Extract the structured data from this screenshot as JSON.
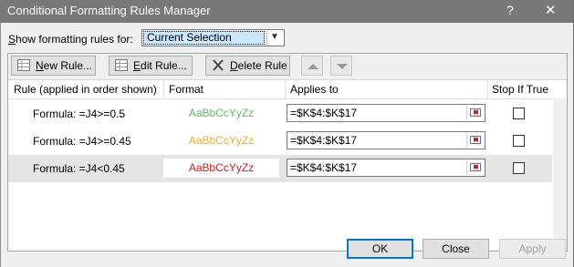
{
  "window": {
    "title": "Conditional Formatting Rules Manager",
    "help_label": "?",
    "close_label": "✕"
  },
  "show_rules": {
    "label_before": "",
    "label_accel": "S",
    "label_after": "how formatting rules for:",
    "selected": "Current Selection"
  },
  "toolbar": {
    "new_rule": {
      "accel": "N",
      "rest": "ew Rule..."
    },
    "edit_rule": {
      "accel": "E",
      "rest": "dit Rule..."
    },
    "delete_rule": {
      "accel": "D",
      "rest": "elete Rule"
    }
  },
  "columns": {
    "rule": "Rule (applied in order shown)",
    "format": "Format",
    "applies_to": "Applies to",
    "stop_if_true": "Stop If True"
  },
  "rules": [
    {
      "rule": "Formula: =J4>=0.5",
      "preview": "AaBbCcYyZz",
      "preview_color": "#5cc05c",
      "applies_to": "=$K$4:$K$17",
      "stop_if_true": false
    },
    {
      "rule": "Formula: =J4>=0.45",
      "preview": "AaBbCcYyZz",
      "preview_color": "#f0b020",
      "applies_to": "=$K$4:$K$17",
      "stop_if_true": false
    },
    {
      "rule": "Formula: =J4<0.45",
      "preview": "AaBbCcYyZz",
      "preview_color": "#e01818",
      "applies_to": "=$K$4:$K$17",
      "stop_if_true": false,
      "selected": true
    }
  ],
  "footer": {
    "ok": "OK",
    "close": "Close",
    "apply": "Apply"
  }
}
